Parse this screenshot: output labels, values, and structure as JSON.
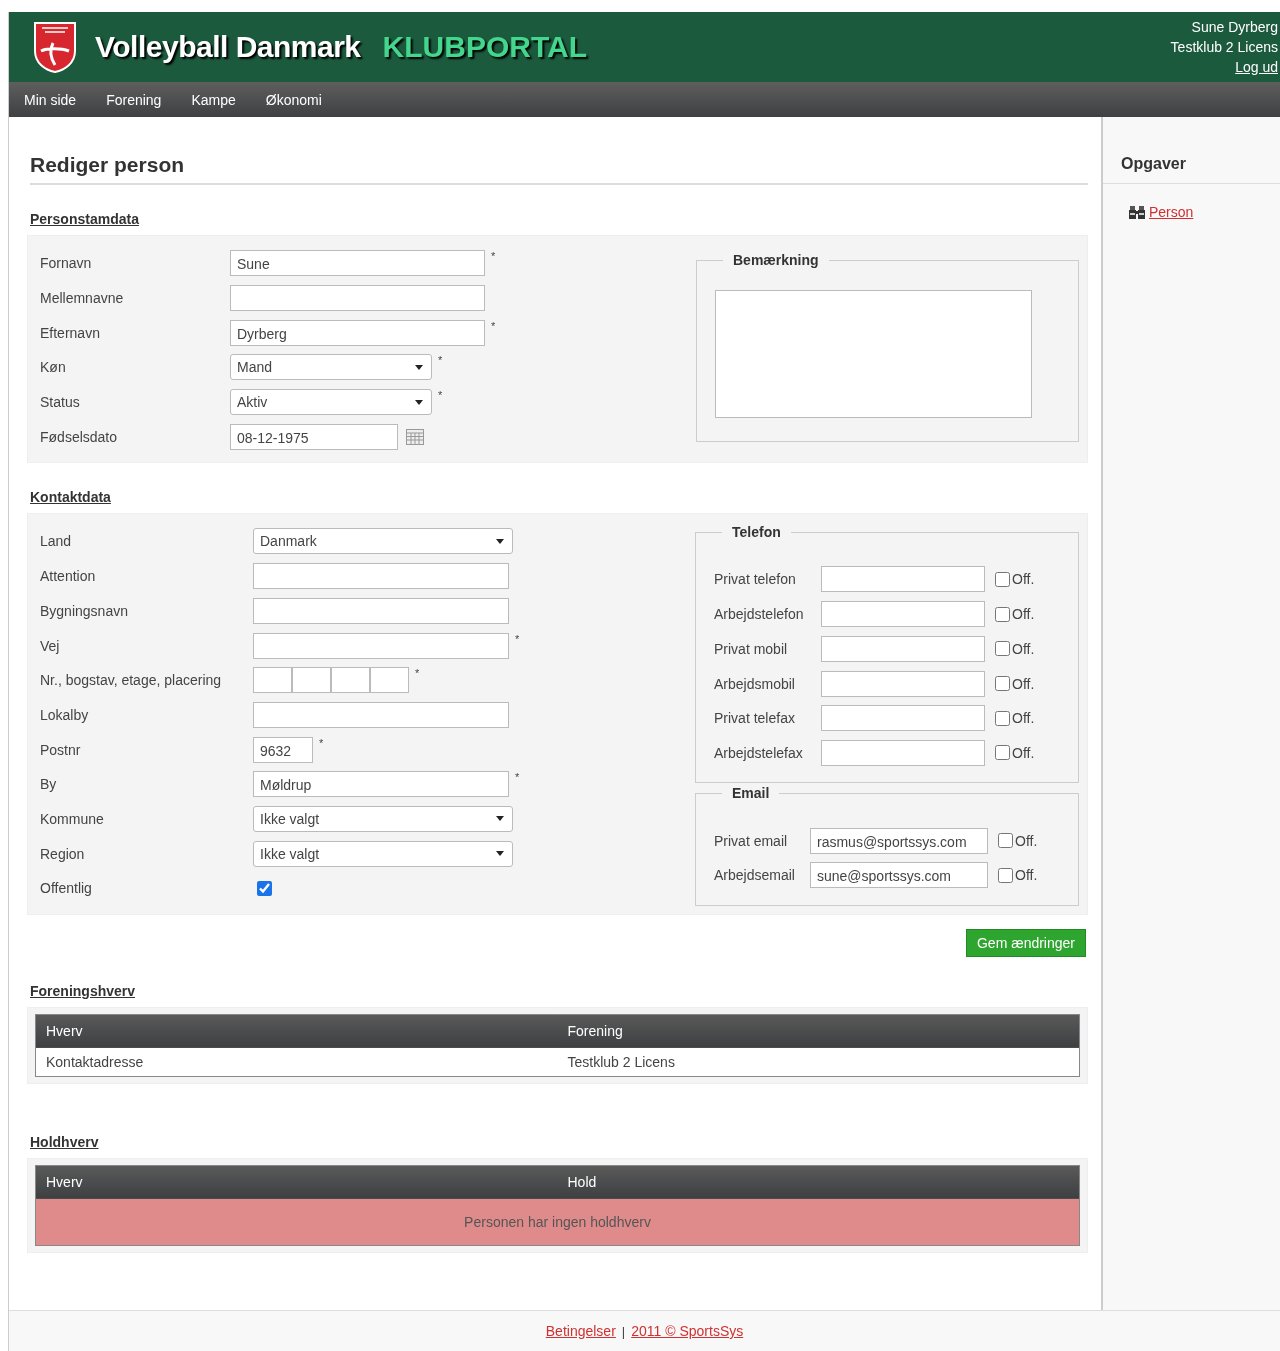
{
  "header": {
    "title": "Volleyball Danmark",
    "subtitle": "KLUBPORTAL",
    "user_name": "Sune Dyrberg",
    "club": "Testklub 2 Licens",
    "logout": "Log ud"
  },
  "nav": [
    "Min side",
    "Forening",
    "Kampe",
    "Økonomi"
  ],
  "page_title": "Rediger person",
  "personstamdata": {
    "heading": "Personstamdata",
    "fields": [
      {
        "label": "Fornavn",
        "kind": "text",
        "value": "Sune",
        "required_mark": "*"
      },
      {
        "label": "Mellemnavne",
        "kind": "text"
      },
      {
        "label": "Efternavn",
        "kind": "text",
        "value": "Dyrberg",
        "required_mark": "*"
      },
      {
        "label": "Køn",
        "kind": "select",
        "value": "Mand",
        "required_mark": "*"
      },
      {
        "label": "Status",
        "kind": "select",
        "value": "Aktiv",
        "required_mark": "*"
      },
      {
        "label": "Fødselsdato",
        "kind": "date",
        "value": "08-12-1975"
      }
    ],
    "remark": {
      "legend": "Bemærkning"
    }
  },
  "kontaktdata": {
    "heading": "Kontaktdata",
    "fields": [
      {
        "label": "Land",
        "kind": "select",
        "value": "Danmark"
      },
      {
        "label": "Attention",
        "kind": "text"
      },
      {
        "label": "Bygningsnavn",
        "kind": "text"
      },
      {
        "label": "Vej",
        "kind": "text",
        "required_mark": "*"
      },
      {
        "label": "Nr., bogstav, etage, placering",
        "kind": "multi",
        "required_mark": "*"
      },
      {
        "label": "Lokalby",
        "kind": "text"
      },
      {
        "label": "Postnr",
        "kind": "short",
        "value": "9632",
        "required_mark": "*"
      },
      {
        "label": "By",
        "kind": "text",
        "value": "Møldrup",
        "required_mark": "*"
      },
      {
        "label": "Kommune",
        "kind": "select",
        "value": "Ikke valgt"
      },
      {
        "label": "Region",
        "kind": "select",
        "value": "Ikke valgt"
      },
      {
        "label": "Offentlig",
        "kind": "checkbox",
        "checked": true
      }
    ],
    "telefon": {
      "legend": "Telefon",
      "rows": [
        {
          "label": "Privat telefon",
          "public_label": "Off.",
          "public": false
        },
        {
          "label": "Arbejdstelefon",
          "public_label": "Off.",
          "public": false
        },
        {
          "label": "Privat mobil",
          "public_label": "Off.",
          "public": false
        },
        {
          "label": "Arbejdsmobil",
          "public_label": "Off.",
          "public": false
        },
        {
          "label": "Privat telefax",
          "public_label": "Off.",
          "public": false
        },
        {
          "label": "Arbejdstelefax",
          "public_label": "Off.",
          "public": false
        }
      ]
    },
    "email": {
      "legend": "Email",
      "rows": [
        {
          "label": "Privat email",
          "value": "rasmus@sportssys.com",
          "public_label": "Off.",
          "public": false
        },
        {
          "label": "Arbejdsemail",
          "value": "sune@sportssys.com",
          "public_label": "Off.",
          "public": false
        }
      ]
    }
  },
  "save_button": "Gem ændringer",
  "foreningshverv": {
    "heading": "Foreningshverv",
    "columns": [
      "Hverv",
      "Forening"
    ],
    "rows": [
      [
        "Kontaktadresse",
        "Testklub 2 Licens"
      ]
    ]
  },
  "holdhverv": {
    "heading": "Holdhverv",
    "columns": [
      "Hverv",
      "Hold"
    ],
    "empty_message": "Personen har ingen holdhverv"
  },
  "sidebar": {
    "title": "Opgaver",
    "links": [
      "Person"
    ]
  },
  "footer": {
    "terms": "Betingelser",
    "separator": "|",
    "copyright": "2011 © SportsSys"
  }
}
